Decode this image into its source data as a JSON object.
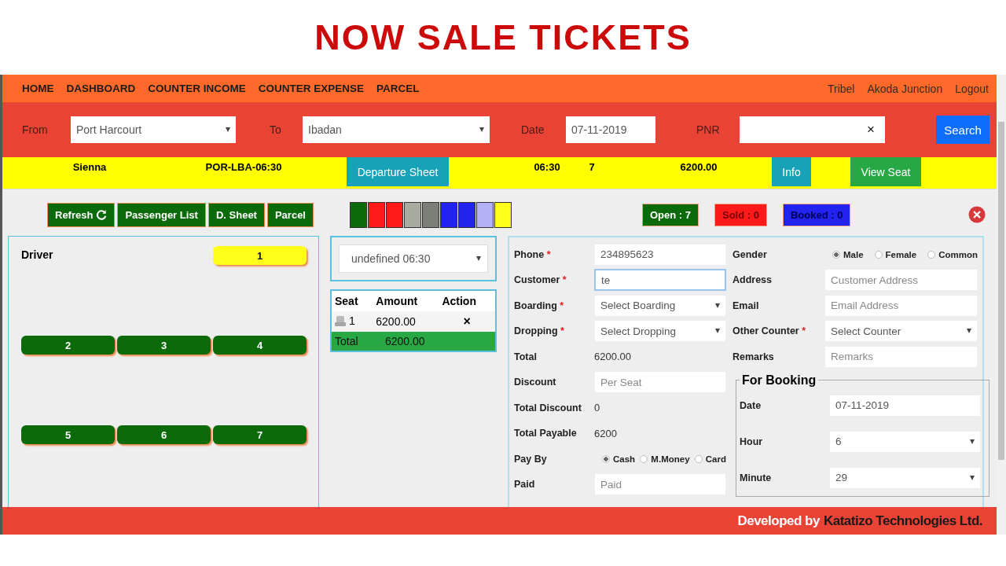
{
  "title": "NOW SALE TICKETS",
  "nav": {
    "items": [
      "HOME",
      "DASHBOARD",
      "COUNTER INCOME",
      "COUNTER EXPENSE",
      "PARCEL"
    ],
    "links": [
      "Tribel",
      "Akoda Junction",
      "Logout"
    ]
  },
  "search_bar": {
    "from": {
      "label": "From",
      "value": "Port Harcourt"
    },
    "to": {
      "label": "To",
      "value": "Ibadan"
    },
    "date": {
      "label": "Date",
      "value": "07-11-2019"
    },
    "pnr": {
      "label": "PNR",
      "clear": "×"
    },
    "button": "Search"
  },
  "trip": {
    "bus": "Sienna",
    "code": "POR-LBA-06:30",
    "departure_button": "Departure Sheet",
    "time": "06:30",
    "seats": "7",
    "fare": "6200.00",
    "info_button": "Info",
    "view_button": "View Seat"
  },
  "toolbar": {
    "refresh": "Refresh",
    "buttons": [
      "Passenger List",
      "D. Sheet",
      "Parcel"
    ]
  },
  "legend": [
    {
      "color": "#0b6b0b"
    },
    {
      "color": "#ff1a1a"
    },
    {
      "color": "#ff1a1a"
    },
    {
      "color": "#a8aba0"
    },
    {
      "color": "#7c7f78"
    },
    {
      "color": "#2323f0"
    },
    {
      "color": "#2323f0"
    },
    {
      "color": "#b4b0f5"
    },
    {
      "color": "#ffff1a"
    }
  ],
  "counters": [
    {
      "kind": "open",
      "label": "Open : 7",
      "color": "#0b6b0b"
    },
    {
      "kind": "sold",
      "label": "Sold : 0",
      "color": "#ff1a1a"
    },
    {
      "kind": "booked",
      "label": "Booked : 0",
      "color": "#2323f0"
    }
  ],
  "seat_map": {
    "driver": "Driver",
    "seats": [
      {
        "label": "1",
        "selected": true
      },
      {
        "label": "2",
        "selected": false
      },
      {
        "label": "3",
        "selected": false
      },
      {
        "label": "4",
        "selected": false
      },
      {
        "label": "5",
        "selected": false
      },
      {
        "label": "6",
        "selected": false
      },
      {
        "label": "7",
        "selected": false
      }
    ]
  },
  "trip_select": "undefined 06:30",
  "cart": {
    "columns": [
      "Seat",
      "Amount",
      "Action"
    ],
    "rows": [
      {
        "seat": "1",
        "amount": "6200.00",
        "action": "×"
      }
    ],
    "total_label": "Total",
    "total_amount": "6200.00"
  },
  "form": {
    "left": [
      {
        "kind": "input",
        "label": "Phone",
        "required_mark": "*",
        "value": "234895623",
        "focused": false
      },
      {
        "kind": "input",
        "label": "Customer",
        "required_mark": "*",
        "value": "te",
        "focused": true
      },
      {
        "kind": "select",
        "label": "Boarding",
        "required_mark": "*",
        "value": "Select Boarding"
      },
      {
        "kind": "select",
        "label": "Dropping",
        "required_mark": "*",
        "value": "Select Dropping"
      },
      {
        "kind": "text",
        "label": "Total",
        "value": "6200.00"
      },
      {
        "kind": "input",
        "label": "Discount",
        "placeholder": "Per Seat",
        "focused": false
      },
      {
        "kind": "text",
        "label": "Total Discount",
        "value": "0"
      },
      {
        "kind": "text",
        "label": "Total Payable",
        "value": "6200"
      },
      {
        "kind": "radio",
        "label": "Pay By",
        "options": [
          {
            "label": "Cash",
            "selected": true
          },
          {
            "label": "M.Money",
            "selected": false
          },
          {
            "label": "Card",
            "selected": false
          }
        ]
      },
      {
        "kind": "input",
        "label": "Paid",
        "placeholder": "Paid",
        "focused": false
      }
    ],
    "right": [
      {
        "kind": "radio",
        "label": "Gender",
        "options": [
          {
            "label": "Male",
            "selected": true
          },
          {
            "label": "Female",
            "selected": false
          },
          {
            "label": "Common",
            "selected": false
          }
        ]
      },
      {
        "kind": "input",
        "label": "Address",
        "placeholder": "Customer Address",
        "focused": false
      },
      {
        "kind": "input",
        "label": "Email",
        "placeholder": "Email Address",
        "focused": false
      },
      {
        "kind": "select",
        "label": "Other Counter",
        "required_mark": "*",
        "value": "Select Counter"
      },
      {
        "kind": "input",
        "label": "Remarks",
        "placeholder": "Remarks",
        "focused": false
      }
    ],
    "booking": {
      "legend": "For Booking",
      "fields": [
        {
          "kind": "input",
          "label": "Date",
          "value": "07-11-2019",
          "focused": false
        },
        {
          "kind": "select",
          "label": "Hour",
          "value": "6"
        },
        {
          "kind": "select",
          "label": "Minute",
          "value": "29"
        }
      ]
    }
  },
  "footer": {
    "prefix": "Developed by",
    "company": "Katatizo Technologies Ltd."
  }
}
